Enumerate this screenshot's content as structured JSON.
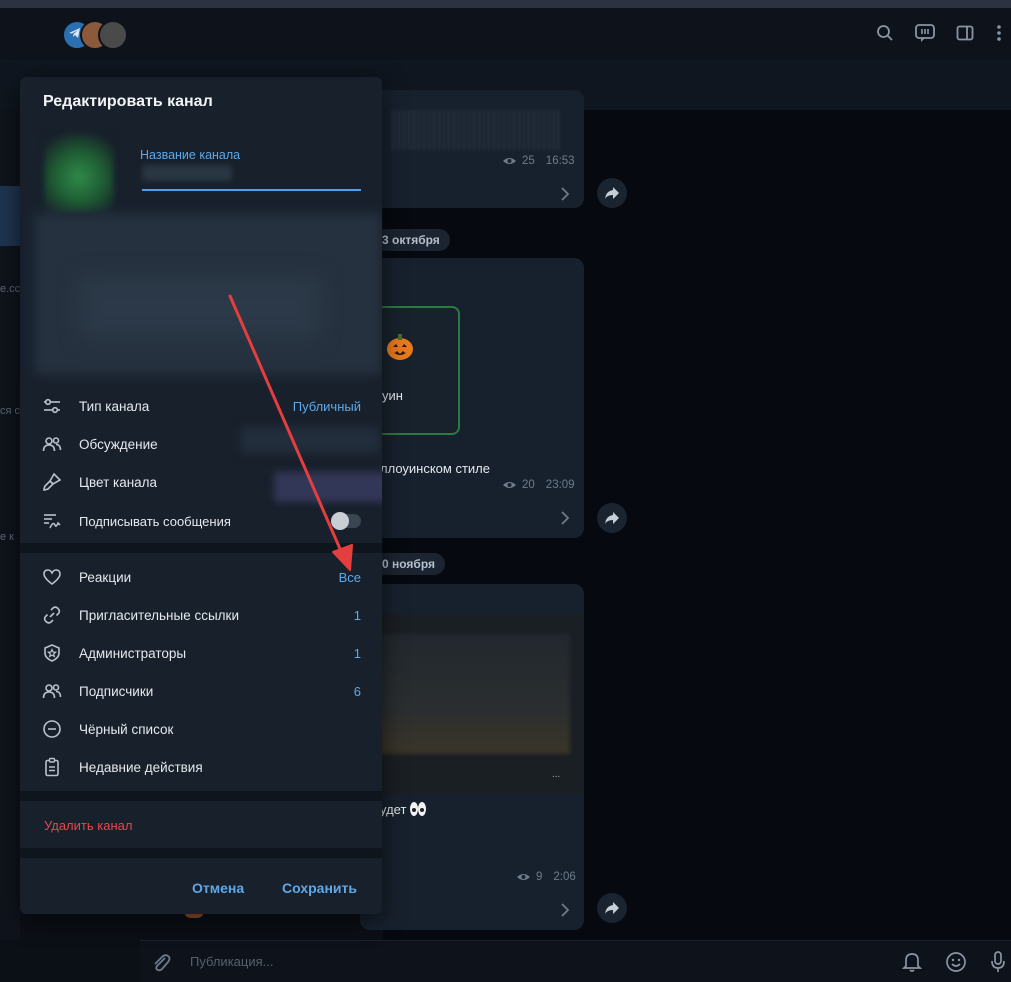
{
  "modal": {
    "title": "Редактировать канал",
    "name_label": "Название канала",
    "rows_group1": [
      {
        "label": "Тип канала",
        "value": "Публичный",
        "icon": "sliders-icon"
      },
      {
        "label": "Обсуждение",
        "value": "",
        "icon": "people-icon"
      },
      {
        "label": "Цвет канала",
        "value": "",
        "icon": "brush-icon"
      },
      {
        "label": "Подписывать сообщения",
        "value": "",
        "icon": "signature-icon",
        "toggle": false
      }
    ],
    "rows_group2": [
      {
        "label": "Реакции",
        "value": "Все",
        "icon": "heart-icon"
      },
      {
        "label": "Пригласительные ссылки",
        "value": "1",
        "icon": "link-icon"
      },
      {
        "label": "Администраторы",
        "value": "1",
        "icon": "shield-star-icon"
      },
      {
        "label": "Подписчики",
        "value": "6",
        "icon": "people-icon"
      },
      {
        "label": "Чёрный список",
        "value": "",
        "icon": "minus-circle-icon"
      },
      {
        "label": "Недавние действия",
        "value": "",
        "icon": "clipboard-icon"
      }
    ],
    "delete_label": "Удалить канал",
    "cancel_label": "Отмена",
    "save_label": "Сохранить"
  },
  "chat": {
    "messages": [
      {
        "views": "25",
        "time": "16:53"
      },
      {
        "date": "3 октября",
        "text": "ллоуинском стиле",
        "card_text": "уин",
        "views": "20",
        "time": "23:09"
      },
      {
        "date": "0 ноября",
        "text": "удет",
        "views": "9",
        "time": "2:06"
      }
    ],
    "left_fragments": [
      "e.cc",
      "ся с",
      "е к"
    ]
  },
  "composer": {
    "placeholder": "Публикация..."
  },
  "colors": {
    "accent": "#5fa8e8",
    "danger": "#e5484d",
    "panel": "#17202b",
    "annotation_arrow": "#e53e3e"
  }
}
